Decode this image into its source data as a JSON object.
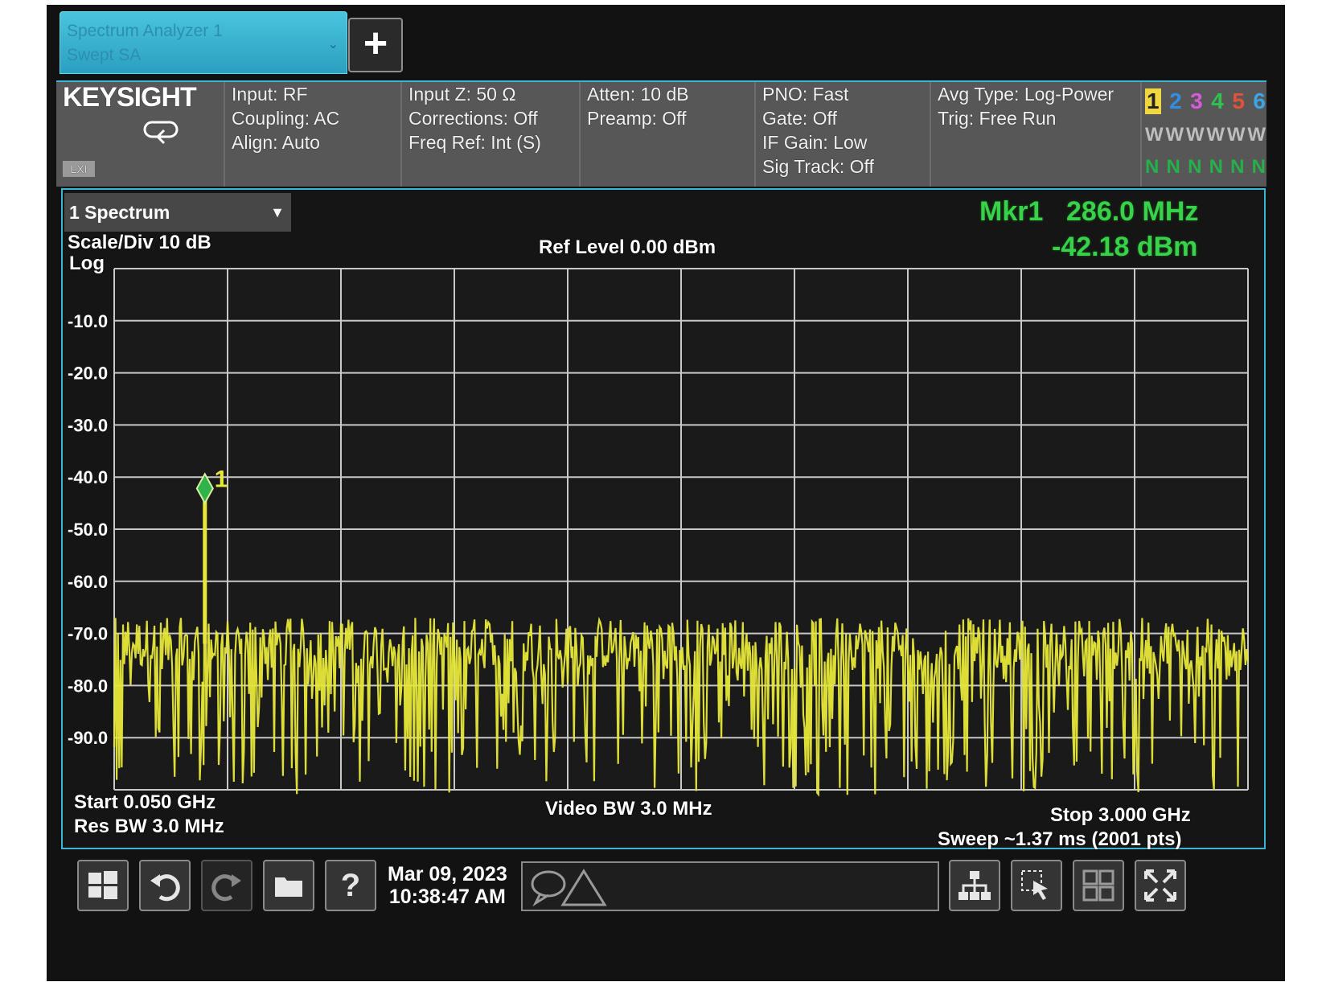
{
  "tabs": {
    "mode_line1": "Spectrum Analyzer 1",
    "mode_line2": "Swept SA",
    "add_label": "+"
  },
  "brand": "KEYSIGHT",
  "settings": {
    "col1": [
      "Input: RF",
      "Coupling: AC",
      "Align: Auto"
    ],
    "col2": [
      "Input Z: 50 Ω",
      "Corrections: Off",
      "Freq Ref: Int (S)"
    ],
    "col3": [
      "Atten: 10 dB",
      "Preamp: Off"
    ],
    "col4": [
      "PNO: Fast",
      "Gate: Off",
      "IF Gain: Low",
      "Sig Track: Off"
    ],
    "col5": [
      "Avg Type: Log-Power",
      "Trig: Free Run"
    ]
  },
  "traces": {
    "numbers": [
      "1",
      "2",
      "3",
      "4",
      "5",
      "6"
    ],
    "types": [
      "W",
      "W",
      "W",
      "W",
      "W",
      "W"
    ],
    "detectors": [
      "N",
      "N",
      "N",
      "N",
      "N",
      "N"
    ]
  },
  "window": {
    "selector": "1 Spectrum",
    "scale": "Scale/Div 10 dB",
    "scale_type": "Log",
    "ref_level": "Ref Level 0.00 dBm",
    "marker_label": "Mkr1",
    "marker_freq": "286.0 MHz",
    "marker_amp": "-42.18 dBm",
    "start": "Start 0.050 GHz",
    "res_bw": "Res BW 3.0 MHz",
    "video_bw": "Video BW 3.0 MHz",
    "stop": "Stop 3.000 GHz",
    "sweep": "Sweep ~1.37 ms (2001 pts)"
  },
  "chart_data": {
    "type": "line",
    "xlabel": "",
    "ylabel": "",
    "x_range_ghz": [
      0.05,
      3.0
    ],
    "ylim": [
      -100,
      0
    ],
    "y_ticks": [
      "-10.0",
      "-20.0",
      "-30.0",
      "-40.0",
      "-50.0",
      "-60.0",
      "-70.0",
      "-80.0",
      "-90.0"
    ],
    "grid": true,
    "trace_color": "#e8e83a",
    "noise_floor_dbm": -72,
    "noise_min_dbm": -97,
    "peak": {
      "freq_ghz": 0.286,
      "amp_dbm": -42.18
    },
    "marker": {
      "label": "1",
      "freq_ghz": 0.286,
      "amp_dbm": -42.18,
      "color": "#2fb34a"
    }
  },
  "taskbar": {
    "date": "Mar 09, 2023",
    "time": "10:38:47 AM",
    "help_label": "?"
  },
  "colors": {
    "accent": "#3fb4d4",
    "marker_text": "#38d24a",
    "trace": "#e8e83a",
    "grid": "#c8c8c8"
  }
}
